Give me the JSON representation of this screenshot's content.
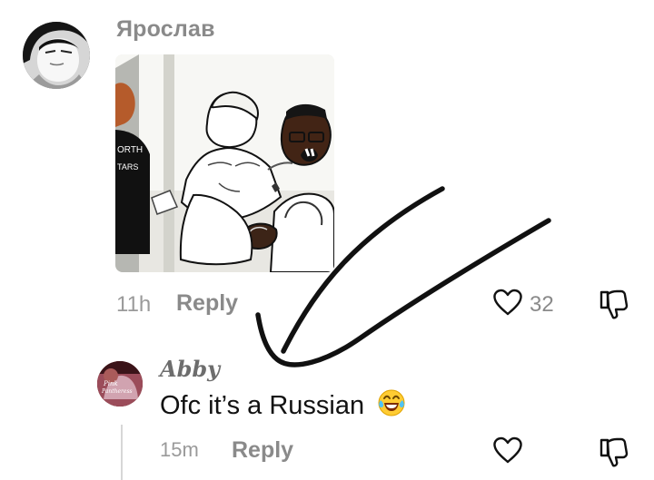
{
  "comment": {
    "username": "Ярослав",
    "time": "11h",
    "reply_label": "Reply",
    "like_count": "32",
    "icons": {
      "like": "heart-outline-icon",
      "dislike": "thumbs-down-outline-icon"
    }
  },
  "reply": {
    "username": "Abby",
    "text": "Ofc it’s a Russian",
    "emoji": "laughing-tears-emoji",
    "time": "15m",
    "reply_label": "Reply",
    "icons": {
      "like": "heart-outline-icon",
      "dislike": "thumbs-down-outline-icon"
    }
  },
  "colors": {
    "secondary_text": "#8a8a8a",
    "primary_text": "#121212",
    "thread_line": "#d7d7d7"
  }
}
